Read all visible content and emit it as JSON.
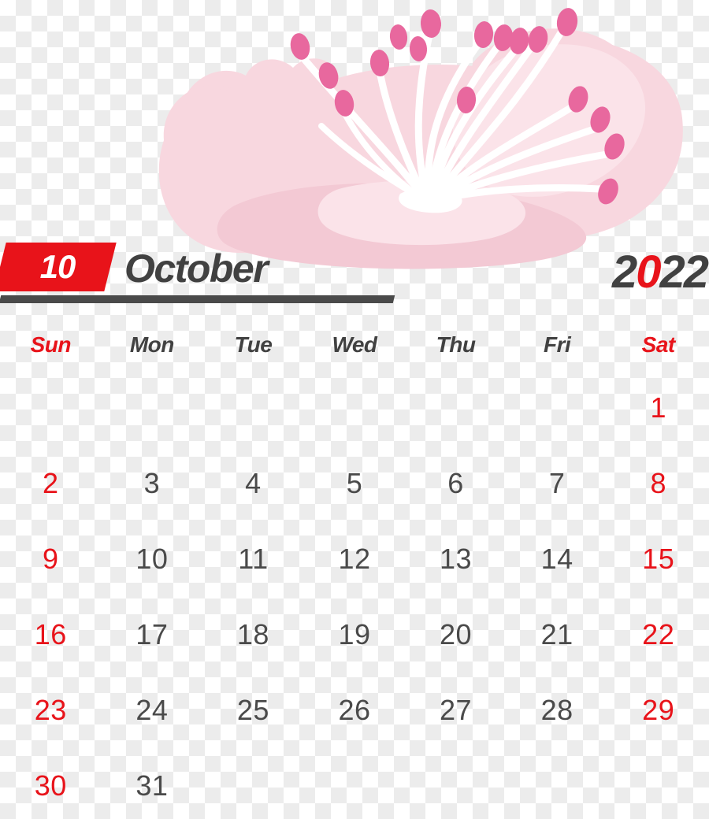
{
  "header": {
    "month_number": "10",
    "month_name": "October",
    "year_part1": "2",
    "year_part2": "0",
    "year_part3": "22",
    "year_full": "2022",
    "accent_red": "#e8131a",
    "dark_gray": "#414141"
  },
  "artwork": {
    "name": "cherry-blossom-flower",
    "petal_color": "#f8d7df",
    "petal_shadow_color": "#f3c9d4",
    "petal_light_color": "#fbe3e9",
    "stamen_color": "#ffffff",
    "anther_color": "#e8689e"
  },
  "calendar": {
    "weekdays": [
      {
        "label": "Sun",
        "weekend": true
      },
      {
        "label": "Mon",
        "weekend": false
      },
      {
        "label": "Tue",
        "weekend": false
      },
      {
        "label": "Wed",
        "weekend": false
      },
      {
        "label": "Thu",
        "weekend": false
      },
      {
        "label": "Fri",
        "weekend": false
      },
      {
        "label": "Sat",
        "weekend": true
      }
    ],
    "weeks": [
      [
        "",
        "",
        "",
        "",
        "",
        "",
        "1"
      ],
      [
        "2",
        "3",
        "4",
        "5",
        "6",
        "7",
        "8"
      ],
      [
        "9",
        "10",
        "11",
        "12",
        "13",
        "14",
        "15"
      ],
      [
        "16",
        "17",
        "18",
        "19",
        "20",
        "21",
        "22"
      ],
      [
        "23",
        "24",
        "25",
        "26",
        "27",
        "28",
        "29"
      ],
      [
        "30",
        "31",
        "",
        "",
        "",
        "",
        ""
      ]
    ],
    "weekend_columns": [
      0,
      6
    ],
    "date_color": "#4a4a4a",
    "weekend_date_color": "#e8131a"
  }
}
